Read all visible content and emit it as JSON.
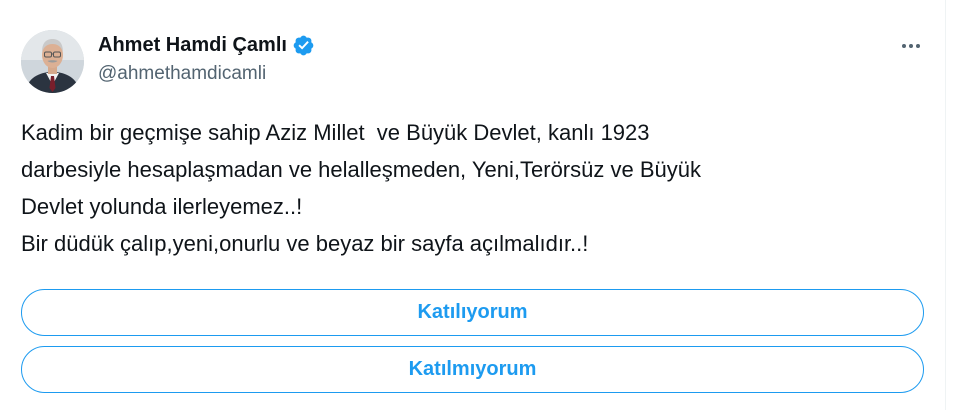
{
  "author": {
    "display_name": "Ahmet Hamdi Çamlı",
    "handle": "@ahmethamdicamli",
    "verified": true,
    "verified_color": "#1d9bf0"
  },
  "icons": {
    "verified": "verified-badge-icon",
    "more": "more-options-icon"
  },
  "tweet": {
    "lines": [
      "Kadim bir geçmişe sahip Aziz Millet  ve Büyük Devlet, kanlı 1923",
      "darbesiyle hesaplaşmadan ve helalleşmeden, Yeni,Terörsüz ve Büyük",
      "Devlet yolunda ilerleyemez..!",
      "Bir düdük çalıp,yeni,onurlu ve beyaz bir sayfa açılmalıdır..!"
    ]
  },
  "poll": {
    "options": [
      {
        "label": "Katılıyorum"
      },
      {
        "label": "Katılmıyorum"
      }
    ],
    "accent_color": "#1d9bf0"
  }
}
